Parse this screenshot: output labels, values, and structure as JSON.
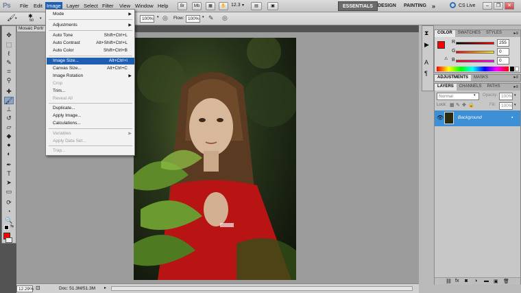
{
  "app": {
    "logo": "Ps"
  },
  "menubar": {
    "items": [
      "File",
      "Edit",
      "Image",
      "Layer",
      "Select",
      "Filter",
      "View",
      "Window",
      "Help"
    ],
    "zoom": "12.3",
    "workspaces": [
      "ESSENTIALS",
      "DESIGN",
      "PAINTING"
    ],
    "more": "»",
    "cslive": "CS Live"
  },
  "options": {
    "brush_size": "50",
    "opacity_value": "100%",
    "flow_label": "Flow:",
    "flow_value": "100%"
  },
  "document": {
    "tab_label": "Mosaic Portr",
    "zoom_value": "12.29%",
    "doc_info": "Doc: 51.3M/51.3M"
  },
  "image_menu": {
    "items": [
      {
        "label": "Mode",
        "shortcut": "",
        "submenu": true,
        "state": "normal"
      },
      {
        "label": "Adjustments",
        "shortcut": "",
        "submenu": true,
        "state": "normal"
      },
      {
        "label": "Auto Tone",
        "shortcut": "Shift+Ctrl+L",
        "submenu": false,
        "state": "normal"
      },
      {
        "label": "Auto Contrast",
        "shortcut": "Alt+Shift+Ctrl+L",
        "submenu": false,
        "state": "normal"
      },
      {
        "label": "Auto Color",
        "shortcut": "Shift+Ctrl+B",
        "submenu": false,
        "state": "normal"
      },
      {
        "label": "Image Size...",
        "shortcut": "Alt+Ctrl+I",
        "submenu": false,
        "state": "highlighted"
      },
      {
        "label": "Canvas Size...",
        "shortcut": "Alt+Ctrl+C",
        "submenu": false,
        "state": "normal"
      },
      {
        "label": "Image Rotation",
        "shortcut": "",
        "submenu": true,
        "state": "normal"
      },
      {
        "label": "Crop",
        "shortcut": "",
        "submenu": false,
        "state": "disabled"
      },
      {
        "label": "Trim...",
        "shortcut": "",
        "submenu": false,
        "state": "normal"
      },
      {
        "label": "Reveal All",
        "shortcut": "",
        "submenu": false,
        "state": "disabled"
      },
      {
        "label": "Duplicate...",
        "shortcut": "",
        "submenu": false,
        "state": "normal"
      },
      {
        "label": "Apply Image...",
        "shortcut": "",
        "submenu": false,
        "state": "normal"
      },
      {
        "label": "Calculations...",
        "shortcut": "",
        "submenu": false,
        "state": "normal"
      },
      {
        "label": "Variables",
        "shortcut": "",
        "submenu": true,
        "state": "disabled"
      },
      {
        "label": "Apply Data Set...",
        "shortcut": "",
        "submenu": false,
        "state": "disabled"
      },
      {
        "label": "Trap...",
        "shortcut": "",
        "submenu": false,
        "state": "disabled"
      }
    ]
  },
  "color_panel": {
    "tabs": [
      "COLOR",
      "SWATCHES",
      "STYLES"
    ],
    "channels": [
      {
        "label": "R",
        "value": "255"
      },
      {
        "label": "G",
        "value": "0"
      },
      {
        "label": "B",
        "value": "0"
      }
    ],
    "foreground": "#ff0000"
  },
  "adjust_panel": {
    "tabs": [
      "ADJUSTMENTS",
      "MASKS"
    ]
  },
  "layers_panel": {
    "tabs": [
      "LAYERS",
      "CHANNELS",
      "PATHS"
    ],
    "blend_mode": "Normal",
    "opacity_label": "Opacity:",
    "opacity_value": "100%",
    "lock_label": "Lock:",
    "fill_label": "Fill:",
    "fill_value": "100%",
    "layers": [
      {
        "name": "Background"
      }
    ]
  },
  "colors": {
    "accent": "#1e5fb4",
    "highlight": "#3d8fd6"
  }
}
